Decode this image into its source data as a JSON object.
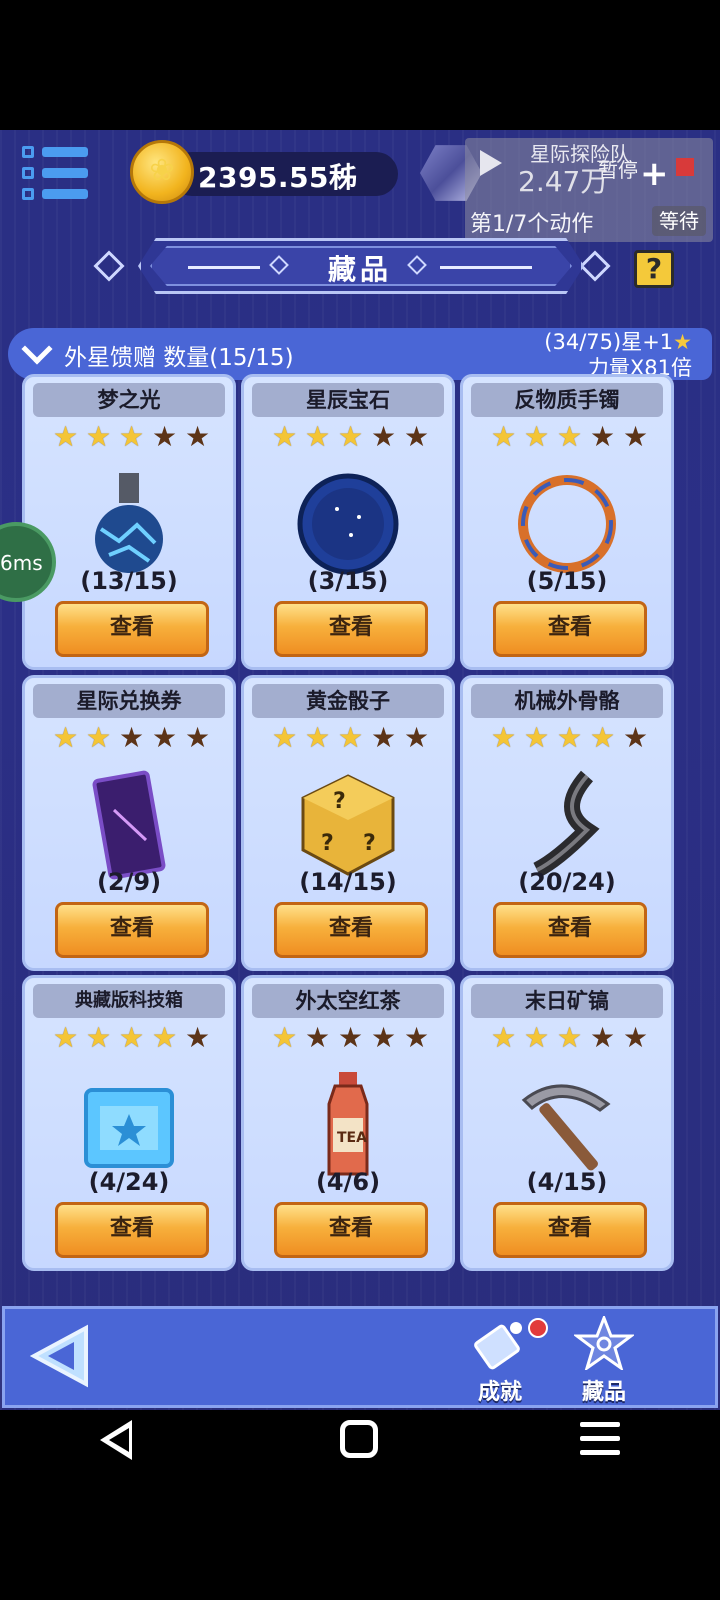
{
  "topbar": {
    "currency_value": "2395.55秭",
    "overlay_title": "星际探险队",
    "overlay_amount": "2.47万",
    "overlay_pause": "暂停",
    "overlay_plus": "+",
    "overlay_action": "第1/7个动作",
    "overlay_wait": "等待"
  },
  "banner": {
    "title": "藏品",
    "help": "?"
  },
  "category": {
    "label": "外星馈赠 数量(15/15)",
    "progress": "(34/75)星+1",
    "star": "★",
    "power": "力量X81倍"
  },
  "ping": "6ms",
  "items": [
    {
      "name": "梦之光",
      "stars": 3,
      "count": "(13/15)",
      "button": "查看"
    },
    {
      "name": "星辰宝石",
      "stars": 3,
      "count": "(3/15)",
      "button": "查看"
    },
    {
      "name": "反物质手镯",
      "stars": 3,
      "count": "(5/15)",
      "button": "查看"
    },
    {
      "name": "星际兑换券",
      "stars": 2,
      "count": "(2/9)",
      "button": "查看"
    },
    {
      "name": "黄金骰子",
      "stars": 3,
      "count": "(14/15)",
      "button": "查看"
    },
    {
      "name": "机械外骨骼",
      "stars": 4,
      "count": "(20/24)",
      "button": "查看"
    },
    {
      "name": "典藏版科技箱",
      "stars": 4,
      "count": "(4/24)",
      "button": "查看"
    },
    {
      "name": "外太空红茶",
      "stars": 1,
      "count": "(4/6)",
      "button": "查看"
    },
    {
      "name": "末日矿镐",
      "stars": 3,
      "count": "(4/15)",
      "button": "查看"
    }
  ],
  "bottom_nav": {
    "achievements": "成就",
    "collection": "藏品"
  },
  "colors": {
    "accent": "#4a66d6",
    "button": "#f7b03c",
    "star_on": "#f4c536",
    "star_off": "#5c3418"
  }
}
